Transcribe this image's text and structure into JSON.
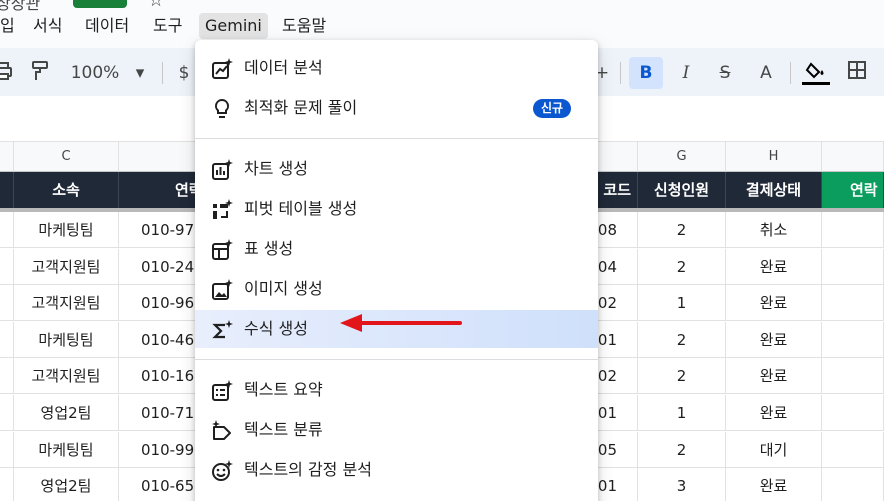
{
  "title": {
    "partial_text": "상장관"
  },
  "menubar": {
    "items": [
      {
        "label": "입"
      },
      {
        "label": "서식"
      },
      {
        "label": "데이터"
      },
      {
        "label": "도구"
      },
      {
        "label": "Gemini"
      },
      {
        "label": "도움말"
      }
    ]
  },
  "toolbar": {
    "zoom": "100%",
    "currency": "$",
    "bold": "B",
    "italic": "I",
    "strike": "S",
    "text_color": "A"
  },
  "columns": {
    "letters": [
      "C",
      "",
      "G",
      "H",
      ""
    ],
    "headers": {
      "c": "소속",
      "d": "연락",
      "f": "코드",
      "g": "신청인원",
      "h": "결제상태",
      "i": "연락"
    }
  },
  "rows": [
    {
      "c": "마케팅팀",
      "d": "010-97",
      "f": "08",
      "g": "2",
      "h": "취소"
    },
    {
      "c": "고객지원팀",
      "d": "010-24",
      "f": "04",
      "g": "2",
      "h": "완료"
    },
    {
      "c": "고객지원팀",
      "d": "010-96",
      "f": "02",
      "g": "1",
      "h": "완료"
    },
    {
      "c": "마케팅팀",
      "d": "010-46",
      "f": "01",
      "g": "2",
      "h": "완료"
    },
    {
      "c": "고객지원팀",
      "d": "010-16",
      "f": "02",
      "g": "2",
      "h": "완료"
    },
    {
      "c": "영업2팀",
      "d": "010-71",
      "f": "01",
      "g": "1",
      "h": "완료"
    },
    {
      "c": "마케팅팀",
      "d": "010-99",
      "f": "05",
      "g": "2",
      "h": "대기"
    },
    {
      "c": "영업2팀",
      "d": "010-65",
      "f": "01",
      "g": "3",
      "h": "완료"
    }
  ],
  "gemini_menu": {
    "items": [
      {
        "label": "데이터 분석",
        "icon": "chart-sparkle-icon"
      },
      {
        "label": "최적화 문제 풀이",
        "icon": "lightbulb-icon",
        "badge": "신규"
      },
      {
        "label": "차트 생성",
        "icon": "bar-chart-sparkle-icon"
      },
      {
        "label": "피벗 테이블 생성",
        "icon": "pivot-table-sparkle-icon"
      },
      {
        "label": "표 생성",
        "icon": "table-sparkle-icon"
      },
      {
        "label": "이미지 생성",
        "icon": "image-sparkle-icon"
      },
      {
        "label": "수식 생성",
        "icon": "sigma-sparkle-icon",
        "highlighted": true
      },
      {
        "label": "텍스트 요약",
        "icon": "list-sparkle-icon"
      },
      {
        "label": "텍스트 분류",
        "icon": "tag-sparkle-icon"
      },
      {
        "label": "텍스트의 감정 분석",
        "icon": "smiley-sparkle-icon"
      }
    ]
  },
  "colors": {
    "header_dark": "#202938",
    "header_green": "#0b9d5d",
    "badge_blue": "#0b57d0",
    "arrow_red": "#e2151b",
    "highlight": "#cfe0fb"
  }
}
